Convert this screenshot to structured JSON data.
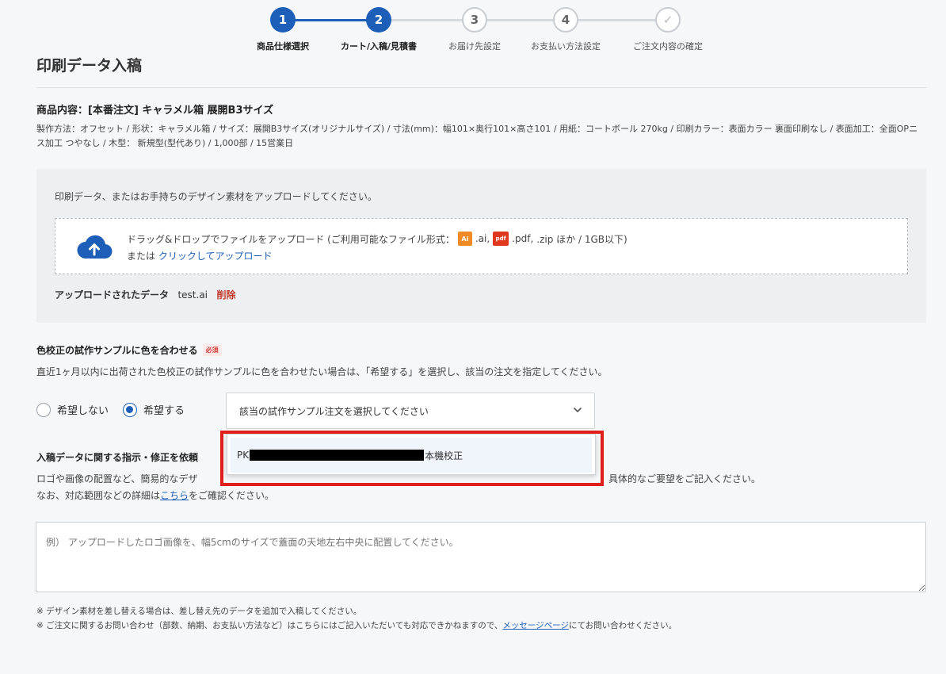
{
  "stepper": {
    "steps": [
      {
        "num": "1",
        "label": "商品仕様選択",
        "state": "done"
      },
      {
        "num": "2",
        "label": "カート/入稿/見積書",
        "state": "done"
      },
      {
        "num": "3",
        "label": "お届け先設定",
        "state": "todo"
      },
      {
        "num": "4",
        "label": "お支払い方法設定",
        "state": "todo"
      },
      {
        "num": "✓",
        "label": "ご注文内容の確定",
        "state": "todo"
      }
    ]
  },
  "page_title": "印刷データ入稿",
  "product": {
    "title": "商品内容：[本番注文] キャラメル箱 展開B3サイズ",
    "desc": "製作方法：オフセット / 形状：キャラメル箱 / サイズ：展開B3サイズ(オリジナルサイズ) / 寸法(mm)：幅101×奥行101×高さ101 / 用紙：コートボール 270kg / 印刷カラー：表面カラー 裏面印刷なし / 表面加工：全面OPニス加工 つやなし / 木型： 新規型(型代あり) / 1,000部 / 15営業日"
  },
  "upload": {
    "intro": "印刷データ、またはお手持ちのデザイン素材をアップロードしてください。",
    "drop_text_prefix": "ドラッグ&ドロップでファイルをアップロード (ご利用可能なファイル形式：",
    "ai_badge": "Ai",
    "ai_ext": ".ai,",
    "pdf_badge": "pdf",
    "pdf_ext": ".pdf,",
    "drop_text_suffix": ".zip ほか / 1GB以下)",
    "or_text": "または",
    "click_upload": "クリックしてアップロード",
    "uploaded_label": "アップロードされたデータ",
    "uploaded_file": "test.ai",
    "delete_label": "削除",
    "icon": "cloud-upload-icon",
    "icon_color": "#1d5fb8"
  },
  "color_match": {
    "title": "色校正の試作サンプルに色を合わせる",
    "required": "必須",
    "desc": "直近1ヶ月以内に出荷された色校正の試作サンプルに色を合わせたい場合は、「希望する」を選択し、該当の注文を指定してください。",
    "option_no": "希望しない",
    "option_yes": "希望する",
    "selected": "yes",
    "select_placeholder": "該当の試作サンプル注文を選択してください",
    "dropdown_item_prefix": "PK",
    "dropdown_item_suffix": "本機校正"
  },
  "instructions": {
    "title": "入稿データに関する指示・修正を依頼",
    "desc1_left": "ロゴや画像の配置など、簡易的なデザ",
    "desc1_right": "具体的なご要望をご記入ください。",
    "desc2_prefix": "なお、対応範囲などの詳細は",
    "desc2_link": "こちら",
    "desc2_suffix": "をご確認ください。",
    "placeholder": "例） アップロードしたロゴ画像を、幅5cmのサイズで蓋面の天地左右中央に配置してください。"
  },
  "notes": {
    "note1": "※ デザイン素材を差し替える場合は、差し替え先のデータを追加で入稿してください。",
    "note2_prefix": "※ ご注文に関するお問い合わせ（部数、納期、お支払い方法など）はこちらにはご記入いただいても対応できかねますので、",
    "note2_link": "メッセージページ",
    "note2_suffix": "にてお問い合わせください。"
  },
  "colors": {
    "accent": "#1d5fb8",
    "highlight": "#e01e1e",
    "delete": "#c0392b"
  }
}
